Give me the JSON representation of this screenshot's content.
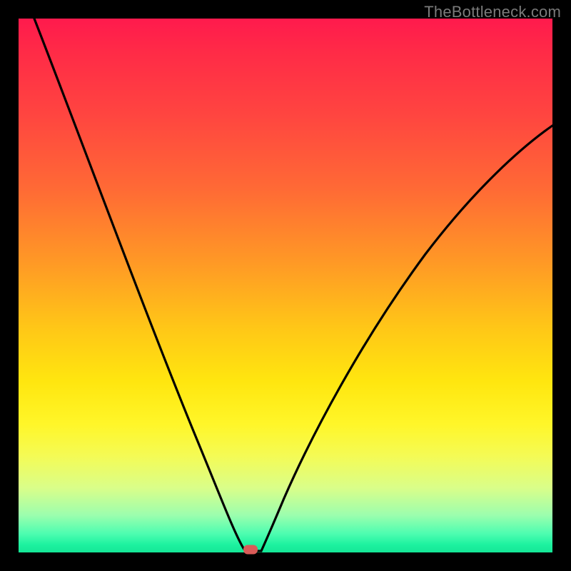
{
  "watermark": "TheBottleneck.com",
  "colors": {
    "frame": "#000000",
    "gradient_top": "#ff1a4d",
    "gradient_mid": "#ffe60f",
    "gradient_bottom": "#14e796",
    "curve": "#000000",
    "marker": "#d95b58"
  },
  "chart_data": {
    "type": "line",
    "title": "",
    "xlabel": "",
    "ylabel": "",
    "xlim": [
      0,
      100
    ],
    "ylim": [
      0,
      100
    ],
    "grid": false,
    "legend": false,
    "series": [
      {
        "name": "bottleneck-curve",
        "x": [
          3,
          7,
          11,
          15,
          19,
          23,
          27,
          30,
          33,
          36,
          38,
          40,
          41,
          42,
          43,
          45,
          47,
          49,
          52,
          56,
          60,
          64,
          68,
          73,
          78,
          84,
          90,
          96,
          100
        ],
        "values": [
          100,
          90,
          80,
          70,
          60,
          50,
          40,
          32,
          25,
          18,
          12,
          6,
          3,
          1,
          0,
          0,
          2,
          6,
          12,
          20,
          28,
          36,
          44,
          52,
          60,
          67,
          73,
          78,
          81
        ]
      }
    ],
    "marker": {
      "x": 43.5,
      "y": 0
    },
    "interpretation": "V-shaped curve with minimum near x≈43; background gradient encodes value (red=high, green=low)."
  }
}
